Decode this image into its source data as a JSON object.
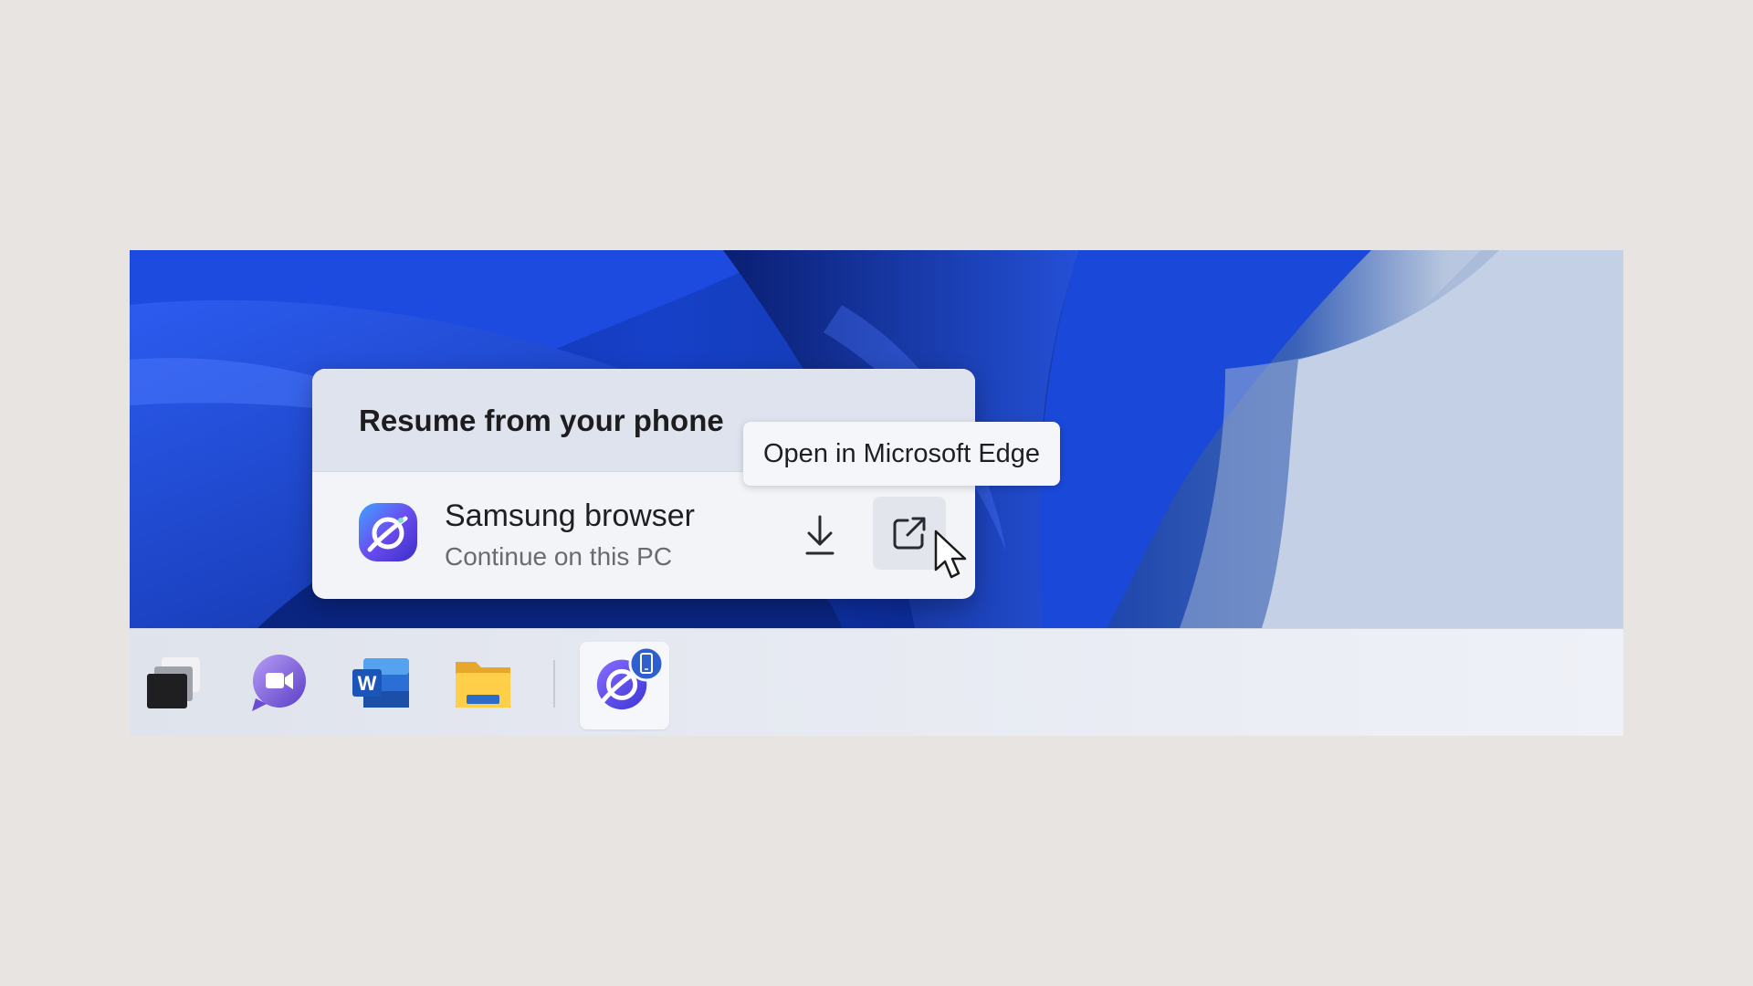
{
  "flyout": {
    "title": "Resume from your phone",
    "app_name": "Samsung browser",
    "app_subtitle": "Continue on this PC",
    "download_icon": "download-icon",
    "open_icon": "open-external-icon"
  },
  "tooltip": {
    "text": "Open in Microsoft Edge"
  },
  "taskbar": {
    "items": [
      {
        "name": "task-view",
        "icon": "task-view-icon"
      },
      {
        "name": "teams-chat",
        "icon": "teams-icon"
      },
      {
        "name": "word",
        "icon": "word-icon"
      },
      {
        "name": "file-explorer",
        "icon": "folder-icon"
      },
      {
        "name": "samsung-browser",
        "icon": "samsung-internet-icon",
        "badge": "phone-icon",
        "active": true
      }
    ]
  },
  "colors": {
    "wallpaper_blue": "#1640c8",
    "flyout_background": "#f3f4f8",
    "flyout_header": "#dfe3ee",
    "taskbar_background": "#e6e9f1",
    "browser_icon_purple": "#6a4df0"
  }
}
